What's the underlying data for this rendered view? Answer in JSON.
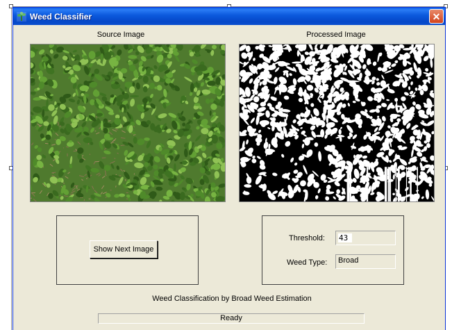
{
  "window": {
    "title": "Weed Classifier",
    "icon": "weed-app-icon",
    "close_glyph": "✕"
  },
  "source": {
    "caption": "Source Image"
  },
  "processed": {
    "caption": "Processed Image"
  },
  "controls": {
    "next_button_label": "Show Next Image",
    "threshold_label": "Threshold:",
    "threshold_value": "43",
    "weed_type_label": "Weed Type:",
    "weed_type_value": "Broad"
  },
  "footer": {
    "method_text": "Weed Classification by Broad Weed Estimation",
    "status": "Ready"
  },
  "colors": {
    "titlebar": "#0b58dc",
    "window_bg": "#ece9d8",
    "close_button": "#d3431c"
  }
}
